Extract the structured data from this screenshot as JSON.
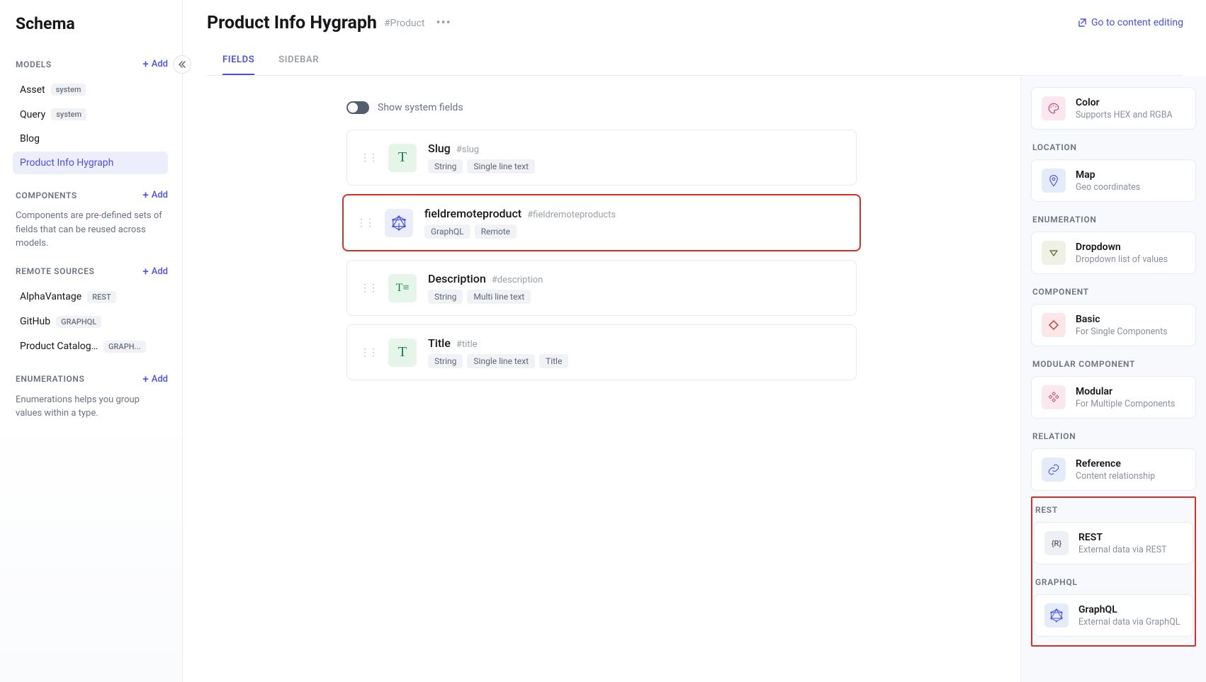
{
  "sidebar": {
    "title": "Schema",
    "addLabel": "Add",
    "sections": {
      "models": {
        "label": "MODELS",
        "items": [
          {
            "name": "Asset",
            "badge": "system"
          },
          {
            "name": "Query",
            "badge": "system"
          },
          {
            "name": "Blog",
            "badge": null
          },
          {
            "name": "Product Info Hygraph",
            "badge": null,
            "active": true
          }
        ]
      },
      "components": {
        "label": "COMPONENTS",
        "desc": "Components are pre-defined sets of fields that can be reused across models."
      },
      "remoteSources": {
        "label": "REMOTE SOURCES",
        "items": [
          {
            "name": "AlphaVantage",
            "badge": "REST"
          },
          {
            "name": "GitHub",
            "badge": "GRAPHQL"
          },
          {
            "name": "Product Catalog...",
            "badge": "GRAPH..."
          }
        ]
      },
      "enumerations": {
        "label": "ENUMERATIONS",
        "desc": "Enumerations helps you group values within a type."
      }
    }
  },
  "header": {
    "title": "Product Info Hygraph",
    "apiId": "#Product",
    "goToEditing": "Go to content editing",
    "tabs": {
      "fields": "FIELDS",
      "sidebar": "SIDEBAR"
    }
  },
  "toggle": {
    "label": "Show system fields"
  },
  "fields": [
    {
      "name": "Slug",
      "api": "#slug",
      "iconType": "T",
      "tags": [
        "String",
        "Single line text"
      ]
    },
    {
      "name": "fieldremoteproduct",
      "api": "#fieldremoteproducts",
      "iconType": "graphql",
      "tags": [
        "GraphQL",
        "Remote"
      ],
      "highlighted": true
    },
    {
      "name": "Description",
      "api": "#description",
      "iconType": "TE",
      "tags": [
        "String",
        "Multi line text"
      ]
    },
    {
      "name": "Title",
      "api": "#title",
      "iconType": "T",
      "tags": [
        "String",
        "Single line text",
        "Title"
      ]
    }
  ],
  "fieldTypes": [
    {
      "section": null,
      "items": [
        {
          "name": "Color",
          "desc": "Supports HEX and RGBA",
          "icon": "palette",
          "color": "pink"
        }
      ]
    },
    {
      "section": "LOCATION",
      "items": [
        {
          "name": "Map",
          "desc": "Geo coordinates",
          "icon": "pin",
          "color": "lblue"
        }
      ]
    },
    {
      "section": "ENUMERATION",
      "items": [
        {
          "name": "Dropdown",
          "desc": "Dropdown list of values",
          "icon": "triangle",
          "color": "olive"
        }
      ]
    },
    {
      "section": "COMPONENT",
      "items": [
        {
          "name": "Basic",
          "desc": "For Single Components",
          "icon": "diamond",
          "color": "rose"
        }
      ]
    },
    {
      "section": "MODULAR COMPONENT",
      "items": [
        {
          "name": "Modular",
          "desc": "For Multiple Components",
          "icon": "diamonds",
          "color": "rose2"
        }
      ]
    },
    {
      "section": "RELATION",
      "items": [
        {
          "name": "Reference",
          "desc": "Content relationship",
          "icon": "link",
          "color": "lblue"
        }
      ]
    },
    {
      "section": "REST",
      "highlighted": true,
      "items": [
        {
          "name": "REST",
          "desc": "External data via REST",
          "icon": "rest",
          "color": "gray"
        }
      ]
    },
    {
      "section": "GRAPHQL",
      "highlighted": true,
      "items": [
        {
          "name": "GraphQL",
          "desc": "External data via GraphQL",
          "icon": "graphql",
          "color": "lblue"
        }
      ]
    }
  ]
}
